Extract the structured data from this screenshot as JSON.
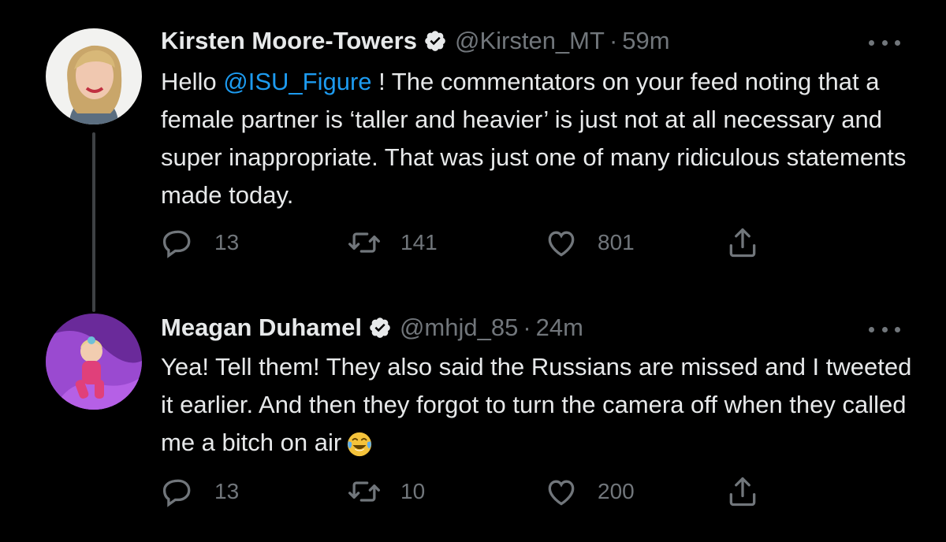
{
  "tweets": [
    {
      "author_name": "Kirsten Moore-Towers",
      "handle": "@Kirsten_MT",
      "separator": "·",
      "time": "59m",
      "text_before": "Hello ",
      "mention": "@ISU_Figure",
      "text_after": " ! The commentators on your feed noting that a female partner is ‘taller and heavier’ is just not at all necessary and super inappropriate. That was just one of many ridiculous statements made today.",
      "replies": "13",
      "retweets": "141",
      "likes": "801"
    },
    {
      "author_name": "Meagan Duhamel",
      "handle": "@mhjd_85",
      "separator": "·",
      "time": "24m",
      "text": "Yea! Tell them! They also said the Russians are missed and I tweeted it earlier. And then they forgot to turn the camera off when they called me a bitch on air",
      "emoji": "face-with-tears-of-joy",
      "replies": "13",
      "retweets": "10",
      "likes": "200"
    }
  ],
  "colors": {
    "background": "#000000",
    "text": "#e7e9ea",
    "secondary": "#71767b",
    "link": "#1d9bf0",
    "thread_line": "#3e4144"
  }
}
